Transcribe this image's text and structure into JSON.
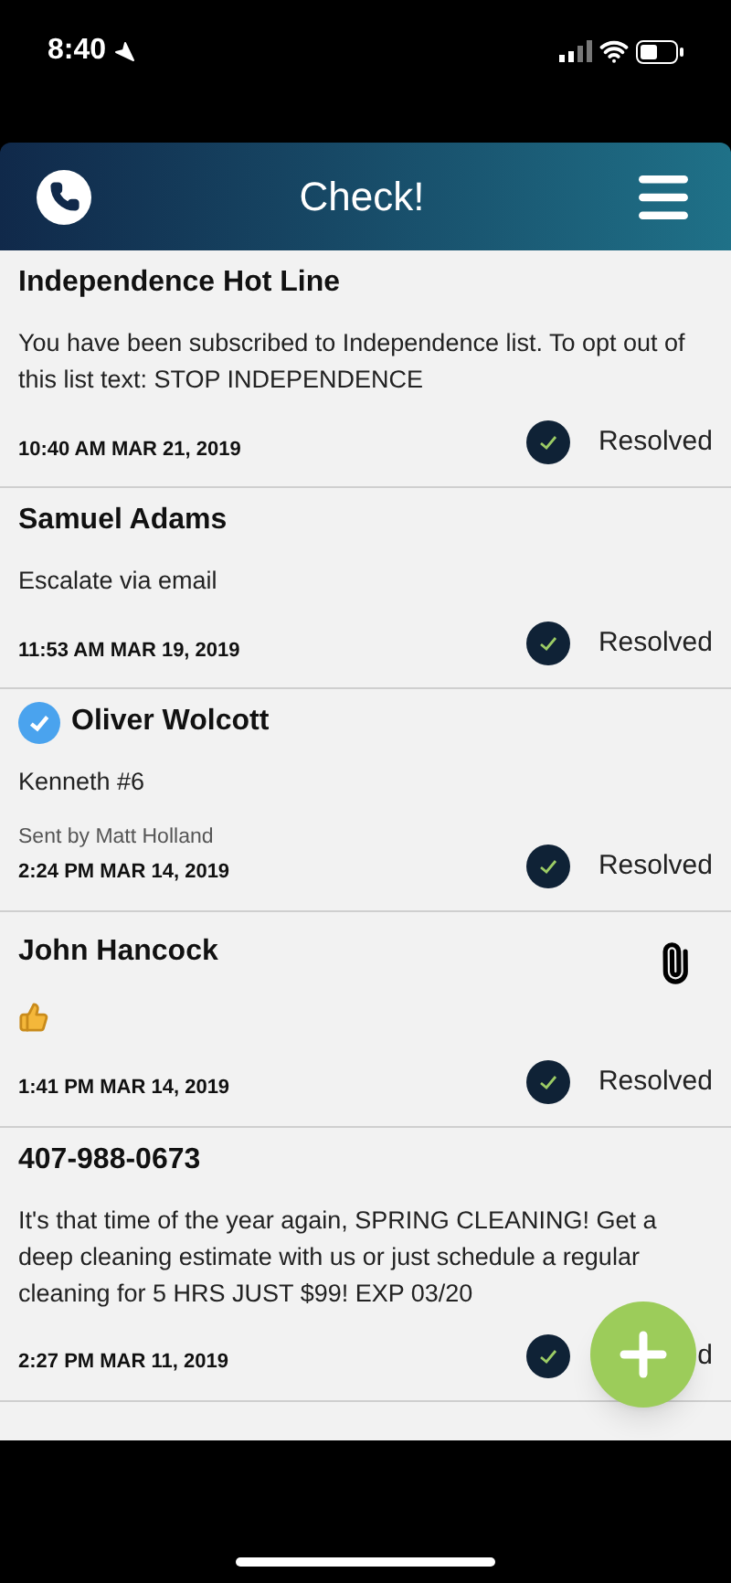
{
  "status_bar": {
    "time": "8:40"
  },
  "header": {
    "title": "Check!"
  },
  "messages": [
    {
      "kind": "text",
      "title": "Independence Hot Line",
      "verified": false,
      "attachment": false,
      "body": "You have been subscribed to Independence list. To opt out of this list text: STOP INDEPENDENCE",
      "time": "10:40 AM MAR 21, 2019",
      "resolved": true,
      "status": "Resolved"
    },
    {
      "kind": "text",
      "title": "Samuel Adams",
      "verified": false,
      "attachment": false,
      "body": "Escalate via email",
      "time": "11:53 AM MAR 19, 2019",
      "resolved": true,
      "status": "Resolved"
    },
    {
      "kind": "text",
      "title": "Oliver Wolcott",
      "verified": true,
      "attachment": false,
      "body": "Kenneth #6",
      "sender": "Sent by Matt Holland",
      "time": "2:24 PM MAR 14, 2019",
      "resolved": true,
      "status": "Resolved"
    },
    {
      "kind": "thumbs_up",
      "title": "John Hancock",
      "verified": false,
      "attachment": true,
      "time": "1:41 PM MAR 14, 2019",
      "resolved": true,
      "status": "Resolved"
    },
    {
      "kind": "text",
      "title": "407-988-0673",
      "verified": false,
      "attachment": false,
      "body": "It's that time of the year again, SPRING CLEANING! Get a deep cleaning estimate with us or just schedule a regular cleaning for 5 HRS JUST $99! EXP 03/20",
      "time": "2:27 PM MAR 11, 2019",
      "resolved": true,
      "status": "d"
    }
  ]
}
